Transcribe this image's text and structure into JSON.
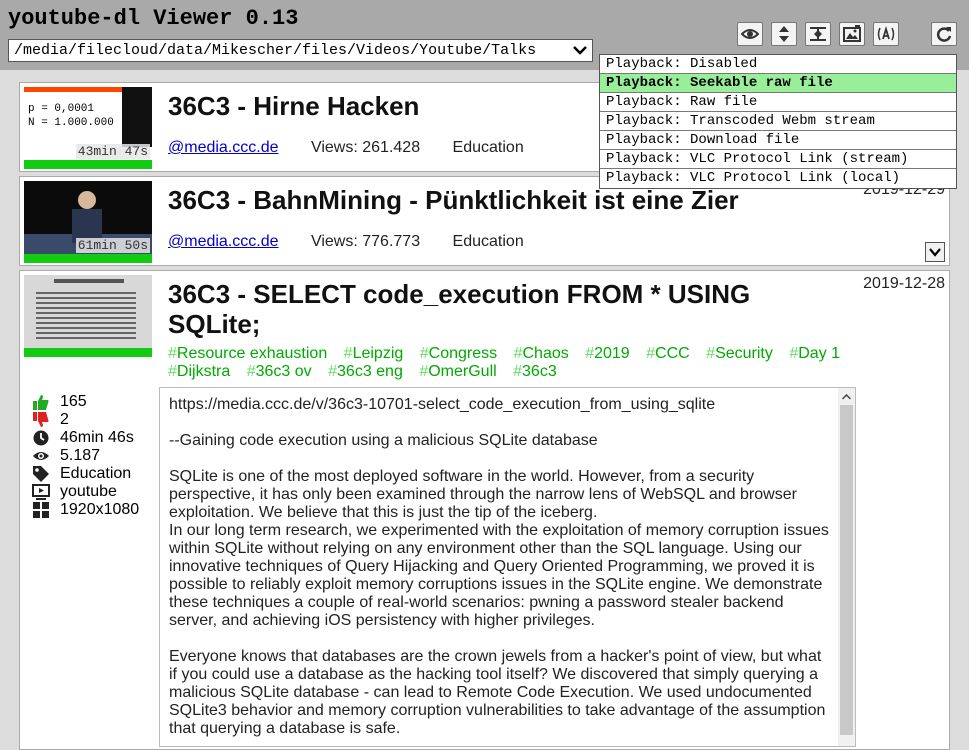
{
  "app": {
    "title": "youtube-dl Viewer 0.13",
    "path": "/media/filecloud/data/Mikescher/files/Videos/Youtube/Talks"
  },
  "toolbar": {
    "icons": [
      "eye-icon",
      "sort-icon",
      "compress-icon",
      "thumbnail-icon",
      "stream-icon",
      "refresh-icon"
    ]
  },
  "playback_menu": {
    "items": [
      "Playback: Disabled",
      "Playback: Seekable raw file",
      "Playback: Raw file",
      "Playback: Transcoded Webm stream",
      "Playback: Download file",
      "Playback: VLC Protocol Link (stream)",
      "Playback: VLC Protocol Link (local)"
    ],
    "selected_index": 1,
    "selected_color": "#99ee99"
  },
  "videos": [
    {
      "title": "36C3 - Hirne Hacken",
      "channel": "@media.ccc.de",
      "views": "Views: 261.428",
      "category": "Education",
      "duration": "43min 47s",
      "thumb_text_1": "p = 0,0001",
      "thumb_text_2": "N = 1.000.000"
    },
    {
      "title": "36C3 - BahnMining - Pünktlichkeit ist eine Zier",
      "channel": "@media.ccc.de",
      "views": "Views: 776.773",
      "category": "Education",
      "duration": "61min 50s",
      "date": "2019-12-29"
    },
    {
      "title": "36C3 - SELECT code_execution FROM * USING SQLite;",
      "date": "2019-12-28",
      "tags": [
        "Resource exhaustion",
        "Leipzig",
        "Congress",
        "Chaos",
        "2019",
        "CCC",
        "Security",
        "Day 1",
        "Dijkstra",
        "36c3 ov",
        "36c3 eng",
        "OmerGull",
        "36c3"
      ],
      "stats": {
        "likes": "165",
        "dislikes": "2",
        "duration": "46min 46s",
        "views": "5.187",
        "category": "Education",
        "source": "youtube",
        "resolution": "1920x1080"
      },
      "description": "https://media.ccc.de/v/36c3-10701-select_code_execution_from_using_sqlite\n\n--Gaining code execution using a malicious SQLite database\n\nSQLite is one of the most deployed software in the world. However, from a security perspective, it has only been examined through the narrow lens of WebSQL and browser exploitation. We believe that this is just the tip of the iceberg.\nIn our long term research, we experimented with the exploitation of memory corruption issues within SQLite without relying on any environment other than the SQL language. Using our innovative techniques of Query Hijacking and Query Oriented Programming, we proved it is possible to reliably exploit memory corruptions issues in the SQLite engine. We demonstrate these techniques a couple of real-world scenarios: pwning a password stealer backend server, and achieving iOS persistency with higher privileges.\n\nEveryone knows that databases are the crown jewels from a hacker's point of view, but what if you could use a database as the hacking tool itself? We discovered that simply querying a malicious SQLite database - can lead to Remote Code Execution. We used undocumented SQLite3 behavior and memory corruption vulnerabilities to take advantage of the assumption that querying a database is safe."
    }
  ]
}
